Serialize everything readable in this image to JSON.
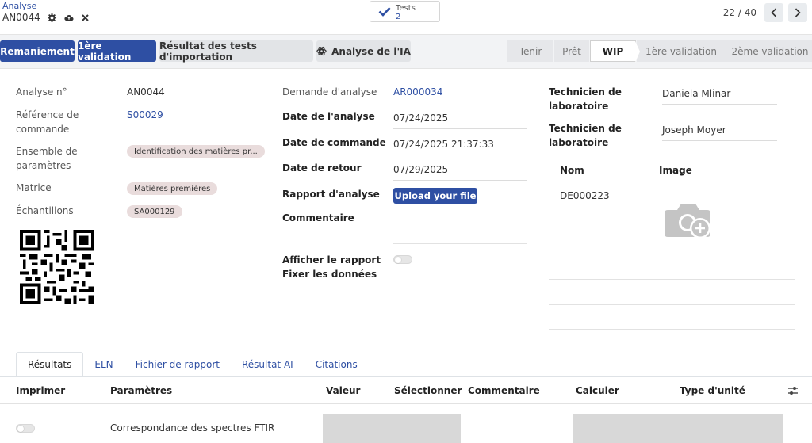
{
  "breadcrumb": {
    "parent": "Analyse",
    "record": "AN0044"
  },
  "smart_button": {
    "label": "Tests",
    "count": "2"
  },
  "pager": {
    "text": "22 / 40"
  },
  "actions": {
    "remaniement": "Remaniement",
    "first_validation": "1ère validation",
    "import_results": "Résultat des tests d'importation",
    "ai_analysis": "Analyse de l'IA"
  },
  "status_stages": [
    "Tenir",
    "Prêt",
    "WIP",
    "1ère validation",
    "2ème validation"
  ],
  "active_stage": "WIP",
  "left": {
    "analysis_no_label": "Analyse n°",
    "analysis_no": "AN0044",
    "order_ref_label": "Référence de commande",
    "order_ref": "S00029",
    "param_set_label": "Ensemble de paramètres",
    "param_set": "Identification des matières pr...",
    "matrix_label": "Matrice",
    "matrix": "Matières premières",
    "samples_label": "Échantillons",
    "sample": "SA000129"
  },
  "middle": {
    "request_label": "Demande d'analyse",
    "request": "AR000034",
    "analysis_date_label": "Date de l'analyse",
    "analysis_date": "07/24/2025",
    "order_date_label": "Date de commande",
    "order_date": "07/24/2025 21:37:33",
    "return_date_label": "Date de retour",
    "return_date": "07/29/2025",
    "report_label": "Rapport d'analyse",
    "upload_label": "Upload your file",
    "comment_label": "Commentaire",
    "show_report_label": "Afficher le rapport",
    "fix_data_label": "Fixer les données"
  },
  "right": {
    "tech1_label": "Technicien de laboratoire",
    "tech1": "Daniela Mlinar",
    "tech2_label": "Technicien de laboratoire",
    "tech2": "Joseph Moyer",
    "name_header": "Nom",
    "image_header": "Image",
    "row_name": "DE000223"
  },
  "tabs": [
    "Résultats",
    "ELN",
    "Fichier de rapport",
    "Résultat AI",
    "Citations"
  ],
  "table": {
    "headers": [
      "Imprimer",
      "Paramètres",
      "Valeur",
      "Sélectionner",
      "Commentaire",
      "Calculer",
      "Type d'unité"
    ],
    "rows": [
      {
        "parametre": "Correspondance des spectres FTIR"
      }
    ]
  },
  "colors": {
    "primary": "#2e4fa3",
    "tag_bg": "#e9dcdc"
  }
}
